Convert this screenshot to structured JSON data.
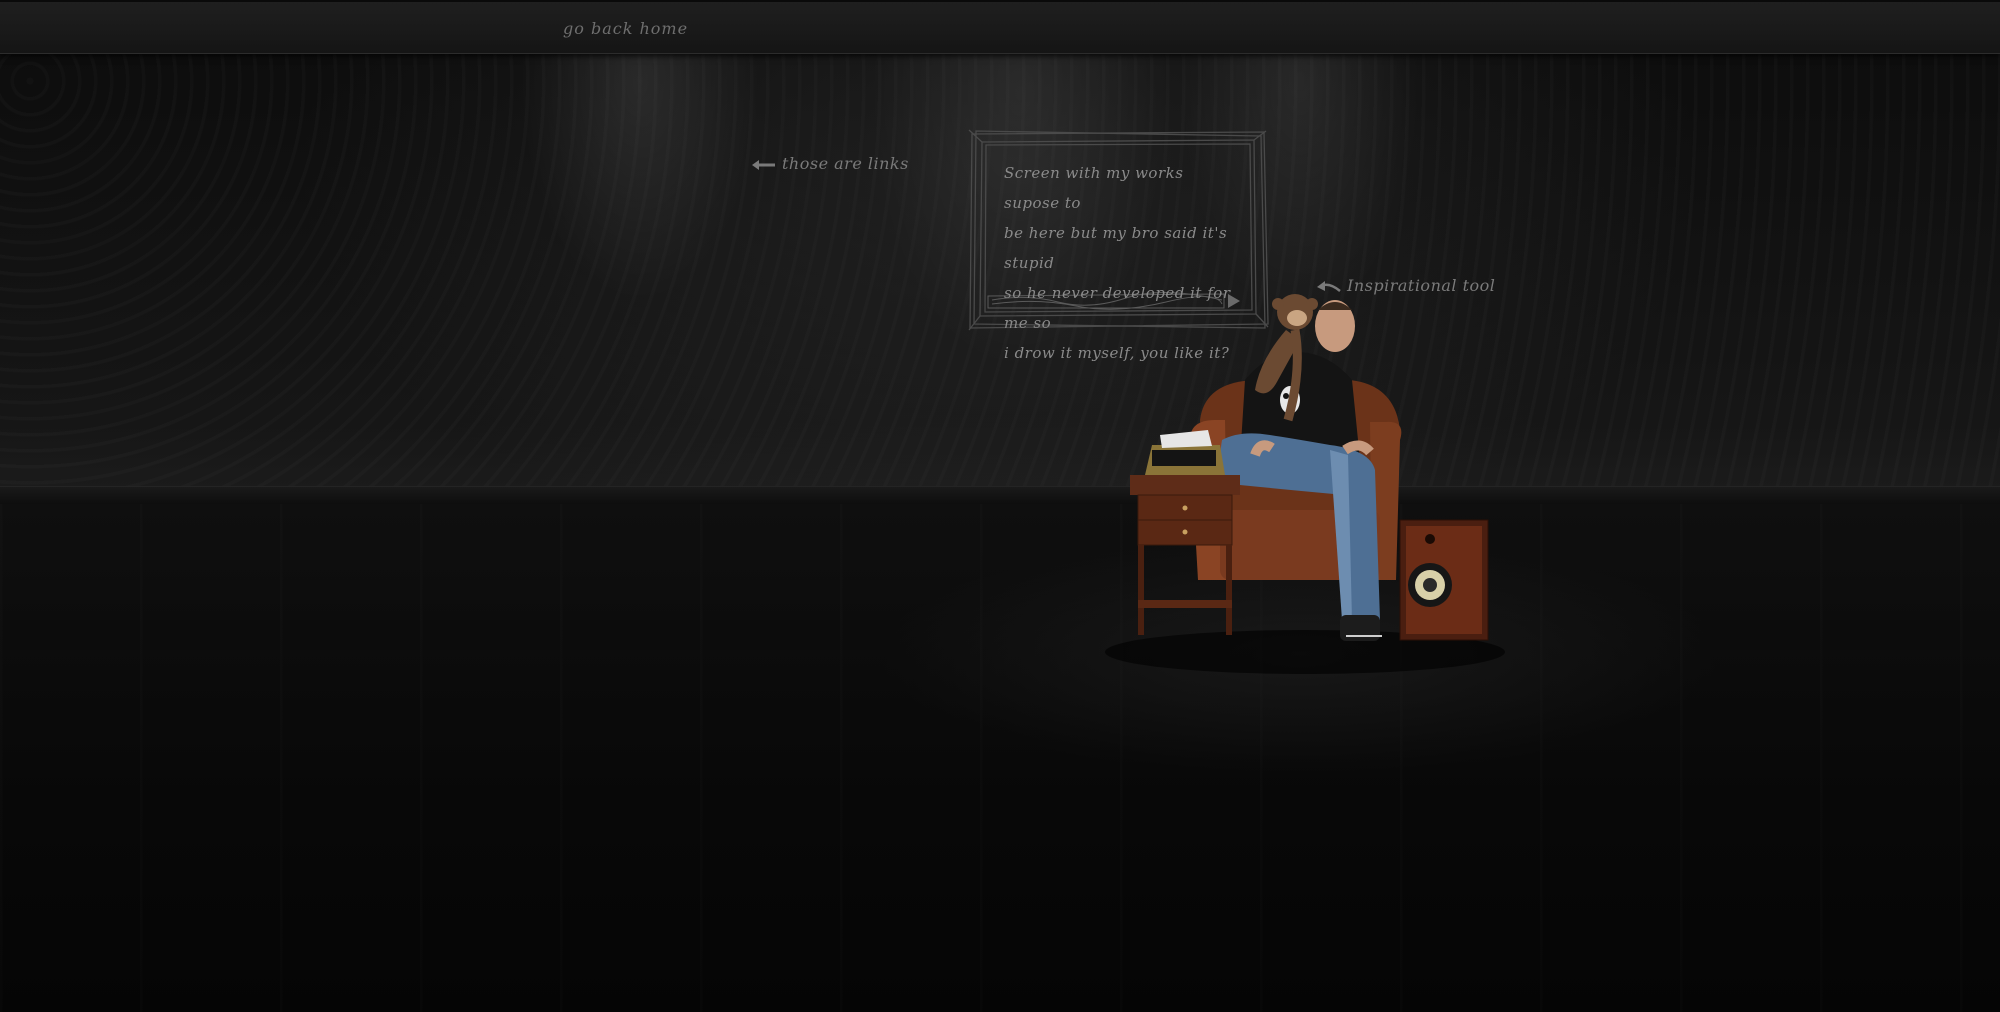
{
  "nav": {
    "go_home_label": "go back home"
  },
  "sketch_note": {
    "lines": [
      "Screen with my works supose to",
      "be here but my bro said it's stupid",
      "so he never developed it for me so",
      "i drow it myself, you like it?"
    ]
  },
  "annotations": {
    "links_hint": "those are links",
    "tool_hint": "Inspirational tool"
  },
  "icons": {
    "links_arrow": "arrow-left-icon",
    "tool_arrow": "curved-arrow-left-icon",
    "play": "play-triangle-icon"
  },
  "colors": {
    "background": "#050505",
    "nav_bar": "#1a1a1a",
    "handwriting": "#8a8a8a",
    "chair": "#7a3a1f",
    "jeans": "#5a7fa6"
  }
}
